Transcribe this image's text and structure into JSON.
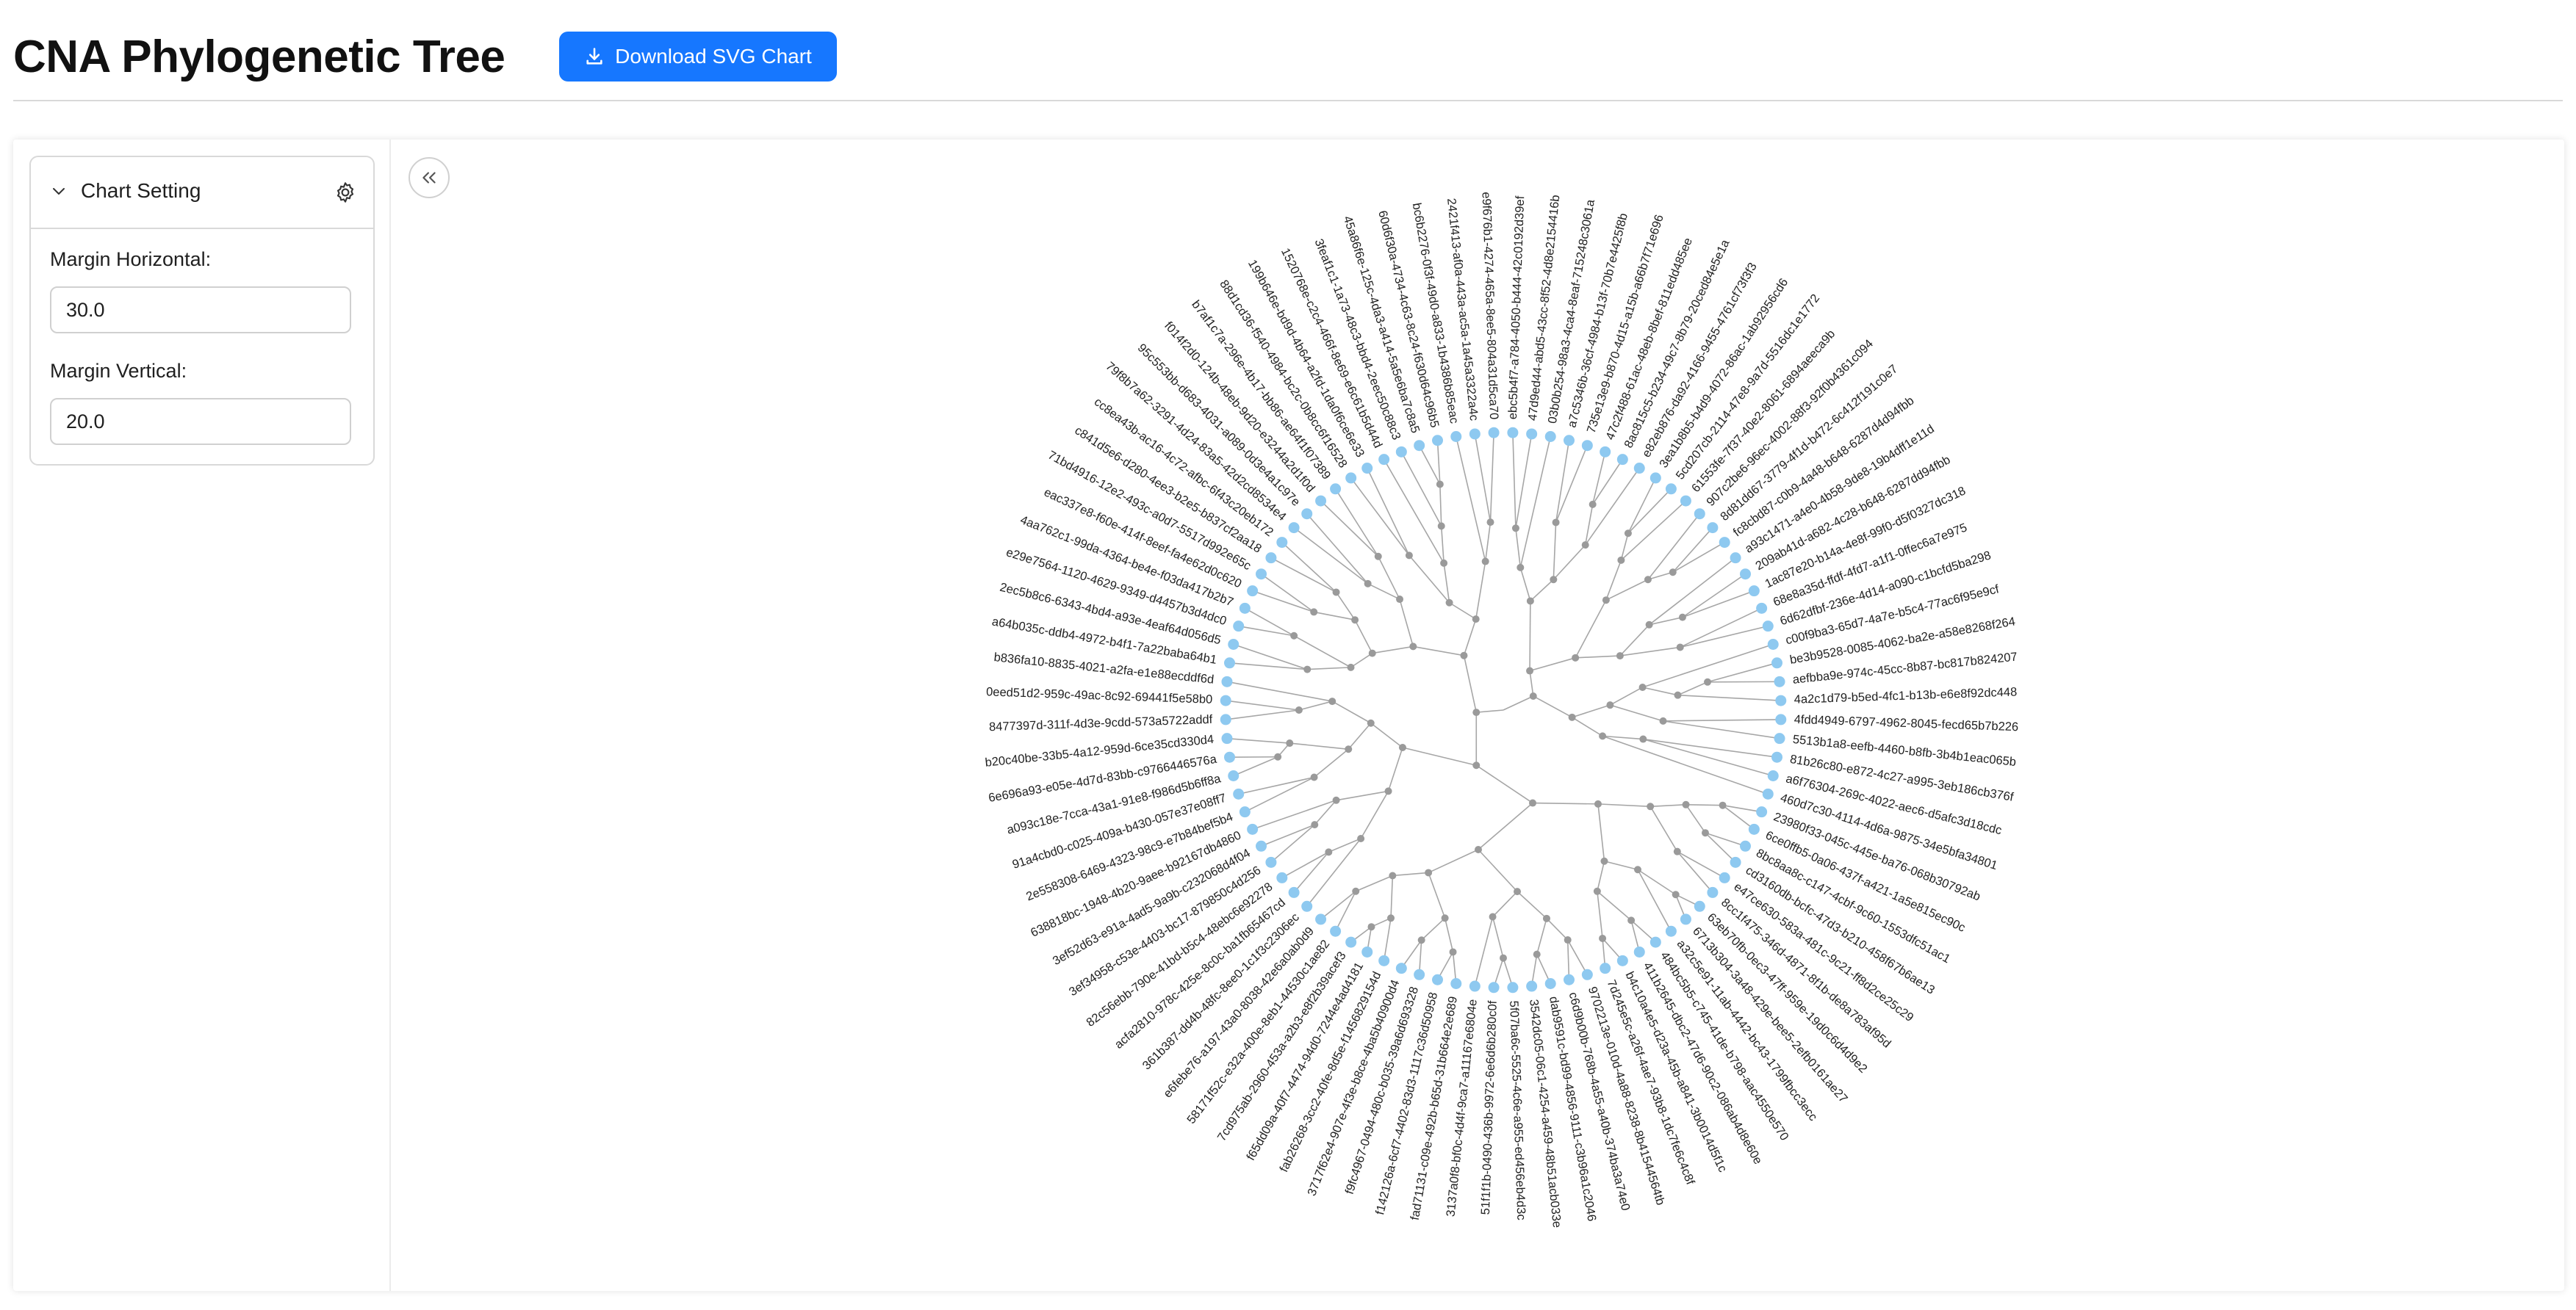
{
  "app": {
    "title": "CNA Phylogenetic Tree"
  },
  "toolbar": {
    "download_label": "Download SVG Chart",
    "download_icon": "download-icon"
  },
  "sidebar": {
    "card_title": "Chart Setting",
    "margin_horizontal": {
      "label": "Margin Horizontal:",
      "value": "30.0"
    },
    "margin_vertical": {
      "label": "Margin Vertical:",
      "value": "20.0"
    },
    "collapse_icon": "double-chevron-left-icon"
  },
  "colors": {
    "accent": "#1677ff",
    "leaf": "#8ec9f0",
    "node": "#9a9a9a",
    "link": "#a6a6a6"
  },
  "tree": {
    "type": "radial-dendrogram",
    "leaves": [
      "ebc5b4f7-a784-4050-b444-42c0192d39ef",
      "47d9ed44-abd5-43cc-8f52-4d8e2154416b",
      "03b0b254-98a3-4ca4-8eaf-715248c3061a",
      "a7c5346b-36cf-4984-b13f-70b7e4425f8b",
      "735e13e9-b870-4d15-a15b-a66b7f71e696",
      "47c2f488-61ac-48eb-8bef-811edd485ee",
      "8ac815c5-b234-49c7-8b79-20ced84e5e1a",
      "e82eb876-da92-4166-9455-4761cf73f3f3",
      "3ea1b8b5-b4d9-4072-86ac-1ab92956cd6",
      "5cd207cb-2114-47e8-9a7d-5516dc1e1772",
      "61553fe-7f37-40e2-8061-6894aeeca9b",
      "907c2be6-96ec-4002-88f3-92f0b4361c094",
      "8d81dd67-3779-4f1d-b472-6c412f191c0e7",
      "fc8cbd87-c0b9-4a48-b648-6287d4d94fbb",
      "a93c1471-a4e0-4b58-9de8-19b4dff1e11d",
      "209ab41d-a682-4c28-b648-6287dd94fbb",
      "1ac87e20-b14a-4e8f-99f0-d5f0327dc318",
      "68e8a35d-ffdf-4fd7-a1f1-0ffec6a7e975",
      "6d62dfbf-236e-4d14-a090-c1bcfd5ba298",
      "c00f9ba3-65d7-4a7e-b5c4-77ac6f95e9cf",
      "be3b9528-0085-4062-ba2e-a58e8268f264",
      "aefbba9e-974c-45cc-8b87-bc817b824207",
      "4a2c1d79-b5ed-4fc1-b13b-e6e8f92dc448",
      "4fdd4949-6797-4962-8045-fecd65b7b226",
      "5513b1a8-eefb-4460-b8fb-3b4b1eac065b",
      "81b26c80-e872-4c27-a995-3eb186cb376f",
      "a6f76304-269c-4022-aec6-d5afc3d18cdc",
      "460d7c30-4114-4d6a-9875-34e5bfa34801",
      "23980f33-045c-445e-ba76-068b30792ab",
      "6ce0ffb5-0a06-437f-a421-1a5e815ec90c",
      "8bc8aa8c-c147-4cbf-9c60-1553dfc51ac1",
      "cd3160db-bcfc-47d3-b210-458f67b6ae13",
      "e47ce630-583a-481c-9c21-ff8d2ce25c29",
      "8cc1f475-346d-4871-8f1b-de8a783af95d",
      "63eb70fb-0ec3-47ff-959e-19d0c6d4d9e2",
      "6713b304-3a48-429e-bee5-2efb0161ae27",
      "a32c5e91-11ab-4442-bc43-1799fbcc3ecc",
      "484bc5b5-c745-41de-b798-aac4550e570",
      "411b2645-dbc2-47d6-90c2-086ab4d8e60e",
      "b4c10a4e5-d23a-45b-a841-3b0014d5f1c",
      "7d245e5c-a26f-4ae7-93b8-1dc7fe6c4c8f",
      "9702213e-010d-4a88-8238-8b41544564tb",
      "c6d9b00b-768b-4a55-a40b-374ba3a74e0",
      "dab9591c-bd99-4856-9111-c3b96a1c2046",
      "3542dc05-06c1-4254-a459-48b51acb033e",
      "5f07ba6c-5525-4c6e-a955-ed456eb4d3c",
      "51f1f1b-0490-436b-9972-6e6d6b280c0f",
      "3137a0f8-bf0c-4d4f-9ca7-a11167e6804e",
      "fad71131-c09e-492b-b65d-31b664e2e689",
      "f142126a-6cf7-4402-83d3-1117c36d50958",
      "f9fc4967-0494-480c-b035-39a6d693328",
      "3717f62e4-907e-4f3e-b8ce-4ba5b40900d4",
      "fab26268-3cc2-40fe-8d5e-f1456829154d",
      "f65dd09a-40f7-4474-94d0-7244e4ad4181",
      "7cd975ab-2960-453a-a2b3-e8f2b39acef3",
      "58171f52c-e32a-400e-8eb1-44530c1ae82",
      "e6febe76-a197-43a0-8038-42e6a0ab0d9",
      "361b387-dd4b-48fc-8ee0-1c1f3c2306ec",
      "acfa2810-978c-425e-8c0c-ba1fb65467cd",
      "82c56ebb-790e-41bd-b5c4-48ebc6e92278",
      "3ef34958-c53e-4403-bc17-879850c4d256",
      "3ef52d63-e91a-4ad5-9a9b-c232068d4f04",
      "638818bc-1948-4b20-9aee-b92167db4860",
      "2e558308-6469-4323-98c9-e7b84bef5b4",
      "91a4cbd0-c025-409a-b430-057e37e08ff7",
      "a093c18e-7cca-43a1-91e8-f986d5b6ff8a",
      "6e696a93-e05e-4d7d-83bb-c9766446576a",
      "b20c40be-33b5-4a12-959d-6ce35cd330d4",
      "8477397d-311f-4d3e-9cdd-573a5722addf",
      "0eed51d2-959c-49ac-8c92-69441f5e58b0",
      "b836fa10-8835-4021-a2fa-e1e88ecddf6d",
      "a64b035c-ddb4-4972-b4f1-7a22baba64b1",
      "2ec5b8c6-6343-4bd4-a93e-4eaf64d056d5",
      "e29e7564-1120-4629-9349-d4457b3d4dc0",
      "4aa762c1-99da-4364-be4e-f03da417b2b7",
      "eac337e8-f60e-414f-8eef-fa4e62d0c620",
      "71bd4916-12e2-493c-a0d7-5517d992e65c",
      "c841d5e6-d280-4ee3-b2e5-b837cf2aa18",
      "cc8ea43b-ac16-4c72-afbc-6f43c20eb172",
      "79f8b7a62-3291-4d24-83a5-42d2cd8534e4",
      "95c553bb-d683-4031-a089-0d3e4a1c97e",
      "f014f2d0-124b-48eb-9d20-e3244a2d1f0d",
      "b7af1c7a-296e-4b17-bb86-ae64f1f07389",
      "88d1cd36-f540-4984-bc2c-0b8cc6f16528",
      "199b646e-bd9d-4b64-a2fd-1da0f6ce6e33",
      "1520768e-c2c4-466f-8e69-e6c61b5d44d",
      "3feaf1c1-1a73-48c3-bbd4-2eec50c88c3",
      "45a86f6e-125c-4da3-a414-5a5e6ba7c8a5",
      "60d6f30a-4734-4c63-8c24-f630d64c96b5",
      "bc6b2276-0f3f-49d0-a833-1b4386b85eac",
      "2421f413-af0a-443a-ac5a-1a45a3322a4c",
      "e9f676b1-4274-465a-8ee5-804a31d5ca70"
    ],
    "internal_node_count": 92
  }
}
